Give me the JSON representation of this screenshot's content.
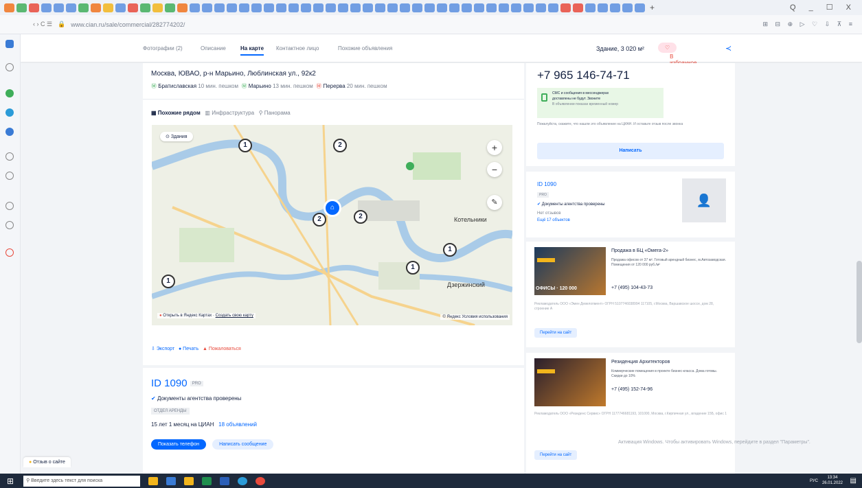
{
  "browser": {
    "url": "www.cian.ru/sale/commercial/282774202/",
    "window_controls": "Q _ ☐ X"
  },
  "subnav": {
    "items": [
      "Фотографии (2)",
      "Описание",
      "На карте",
      "Контактное лицо",
      "Похожие объявления"
    ],
    "active_index": 2,
    "area": "Здание, 3 020 м²",
    "favorite": "В избранное"
  },
  "location": {
    "address": "Москва, ЮВАО, р-н Марьино, Люблинская ул., 92к2",
    "metro": [
      {
        "name": "Братиславская",
        "time": "10 мин. пешком",
        "color": "#3fae5a"
      },
      {
        "name": "Марьино",
        "time": "13 мин. пешком",
        "color": "#3fae5a"
      },
      {
        "name": "Перерва",
        "time": "20 мин. пешком",
        "color": "#e84a3c"
      }
    ]
  },
  "map": {
    "tabs": [
      "Похожие рядом",
      "Инфраструктура",
      "Панорама"
    ],
    "filter": "Здания",
    "clusters": [
      1,
      2,
      2,
      2,
      1,
      1,
      1
    ],
    "labels": {
      "kotelniki": "Котельники",
      "dzerzhinsky": "Дзержинский"
    },
    "open_yandex": "Открыть в Яндекс Картах",
    "create_map": "Создать свою карту",
    "yandex_terms": "© Яндекс Условия использования"
  },
  "actions": {
    "export": "Экспорт",
    "print": "Печать",
    "complain": "Пожаловаться"
  },
  "agent": {
    "id": "ID 1090",
    "badge": "PRO",
    "verified": "Документы агентства проверены",
    "dept": "ОТДЕЛ АРЕНДЫ",
    "tenure": "15 лет 1 месяц на ЦИАН",
    "listings": "18 объявлений",
    "show_phone": "Показать телефон",
    "write_msg": "Написать сообщение"
  },
  "contact": {
    "phone": "+7 965 146-74-71",
    "sms_line1": "СМС и сообщения в мессенджерах",
    "sms_line2": "доставлены не будут. Звоните",
    "sms_line3": "В объявлении показан временный номер",
    "notice": "Пожалуйста, скажите, что нашли это объявление на ЦИАН. И оставьте отзыв после звонка",
    "write": "Написать"
  },
  "agent_side": {
    "id": "ID 1090",
    "badge": "PRO",
    "verified": "Документы агентства проверены",
    "reviews": "Нет отзывов",
    "more": "Ещё 17 объектов"
  },
  "ads": [
    {
      "title": "Продажа в БЦ «Омега-2»",
      "desc": "Продажа офисов от 37 м². Готовый арендный бизнес, м.Автозаводская. Помещения от 120 000 руб./м²",
      "phone": "+7 (495) 104-43-73",
      "overlay": "ОФИСЫ · 120 000",
      "legal": "Рекламодатель ООО «Эмен Девелопмент» ОГРН 5107746038994 117105, г.Москва, Варшавское шоссе, дом 28, строение А",
      "btn": "Перейти на сайт"
    },
    {
      "title": "Резиденция Архитекторов",
      "desc": "Коммерческие помещения в проекте бизнес-класса. Дома готовы. Скидки до 10%",
      "phone": "+7 (495) 152-74-96",
      "legal": "Рекламодатель ООО «Резиденс Сервис» ОГРН 1177746681193, 101000, Москва, г.Кирпичная ул., владение 15Б, офис 1",
      "btn": "Перейти на сайт"
    }
  ],
  "watermark": "Активация Windows. Чтобы активировать Windows, перейдите в раздел \"Параметры\".",
  "feedback": "Отзыв о сайте",
  "taskbar": {
    "search": "Введите здесь текст для поиска",
    "time": "13:34",
    "date": "26.01.2022",
    "lang": "РУС"
  }
}
